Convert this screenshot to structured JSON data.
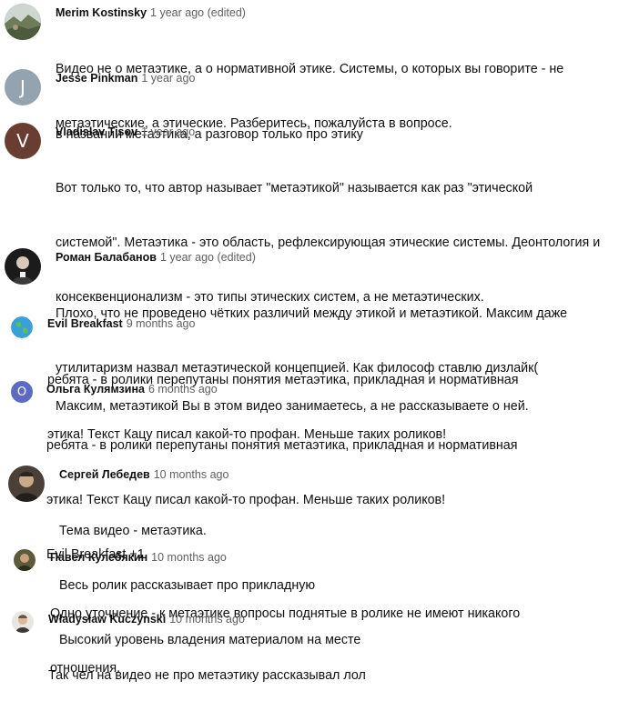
{
  "comments": [
    {
      "author": "Merim Kostinsky",
      "time": "1 year ago (edited)",
      "avatar_icon": "landscape-photo-avatar",
      "lines": [
        "Видео не о метаэтике, а о нормативной этике. Системы, о которых вы говорите - не",
        "метаэтические, а этические. Разберитесь, пожалуйста в вопросе."
      ]
    },
    {
      "author": "Jesse Pinkman",
      "time": "1 year ago",
      "avatar_letter": "J",
      "avatar_color": "#94a3b0",
      "lines": [
        "в названии метаэтика, а разговор только про этику"
      ]
    },
    {
      "author": "Vladislav Tisov",
      "time": "1 year ago",
      "avatar_letter": "V",
      "avatar_color": "#6a3d31",
      "lines": [
        "Вот только то, что автор называет \"метаэтикой\" называется как раз \"этической",
        "системой\". Метаэтика - это область, рефлексирующая этические системы. Деонтология и",
        "консеквенционализм - это типы этических систем, а не метаэтических."
      ],
      "lines2": [
        "Максим, метаэтикой Вы в этом видео занимаетесь, а не рассказываете о ней."
      ]
    },
    {
      "author": "Роман Балабанов",
      "time": "1 year ago (edited)",
      "avatar_icon": "portrait-photo-avatar",
      "lines": [
        "Плохо, что не проведено чётких различий между этикой и метаэтикой. Максим даже",
        "утилитаризм назвал метаэтической концепцией. Как философ ставлю дизлайк("
      ]
    },
    {
      "author": "Evil Breakfast",
      "time": "9 months ago",
      "avatar_icon": "earth-logo-avatar",
      "lines": [
        "ребята - в ролики перепутаны понятия метаэтика, прикладная и нормативная",
        "этика! Текст Кацу писал какой-то профан. Меньше таких роликов!"
      ]
    },
    {
      "author": "Ольга Кулямзина",
      "time": "6 months ago",
      "avatar_letter": "O",
      "avatar_color": "#5c6bc0",
      "lines": [
        "ребята - в ролики перепутаны понятия метаэтика, прикладная и нормативная",
        "этика! Текст Кацу писал какой-то профан. Меньше таких роликов!",
        "Evil Breakfast +1"
      ]
    },
    {
      "author": "Сергей Лебедев",
      "time": "10 months ago",
      "avatar_icon": "portrait-photo-avatar",
      "lines": [
        "Тема видео - метаэтика.",
        "Весь ролик рассказывает про прикладную",
        "Высокий уровень владения материалом на месте"
      ]
    },
    {
      "author": "Павел Кулебякин",
      "time": "10 months ago",
      "avatar_icon": "portrait-photo-avatar",
      "lines": [
        "Одно уточнение - к метаэтике вопросы поднятые в ролике не имеют никакого",
        "отношения."
      ]
    },
    {
      "author": "Władysław Kuczynski",
      "time": "10 months ago",
      "avatar_icon": "portrait-photo-avatar",
      "lines": [
        "Так чел на видео не про метаэтику рассказывал лол"
      ]
    }
  ]
}
